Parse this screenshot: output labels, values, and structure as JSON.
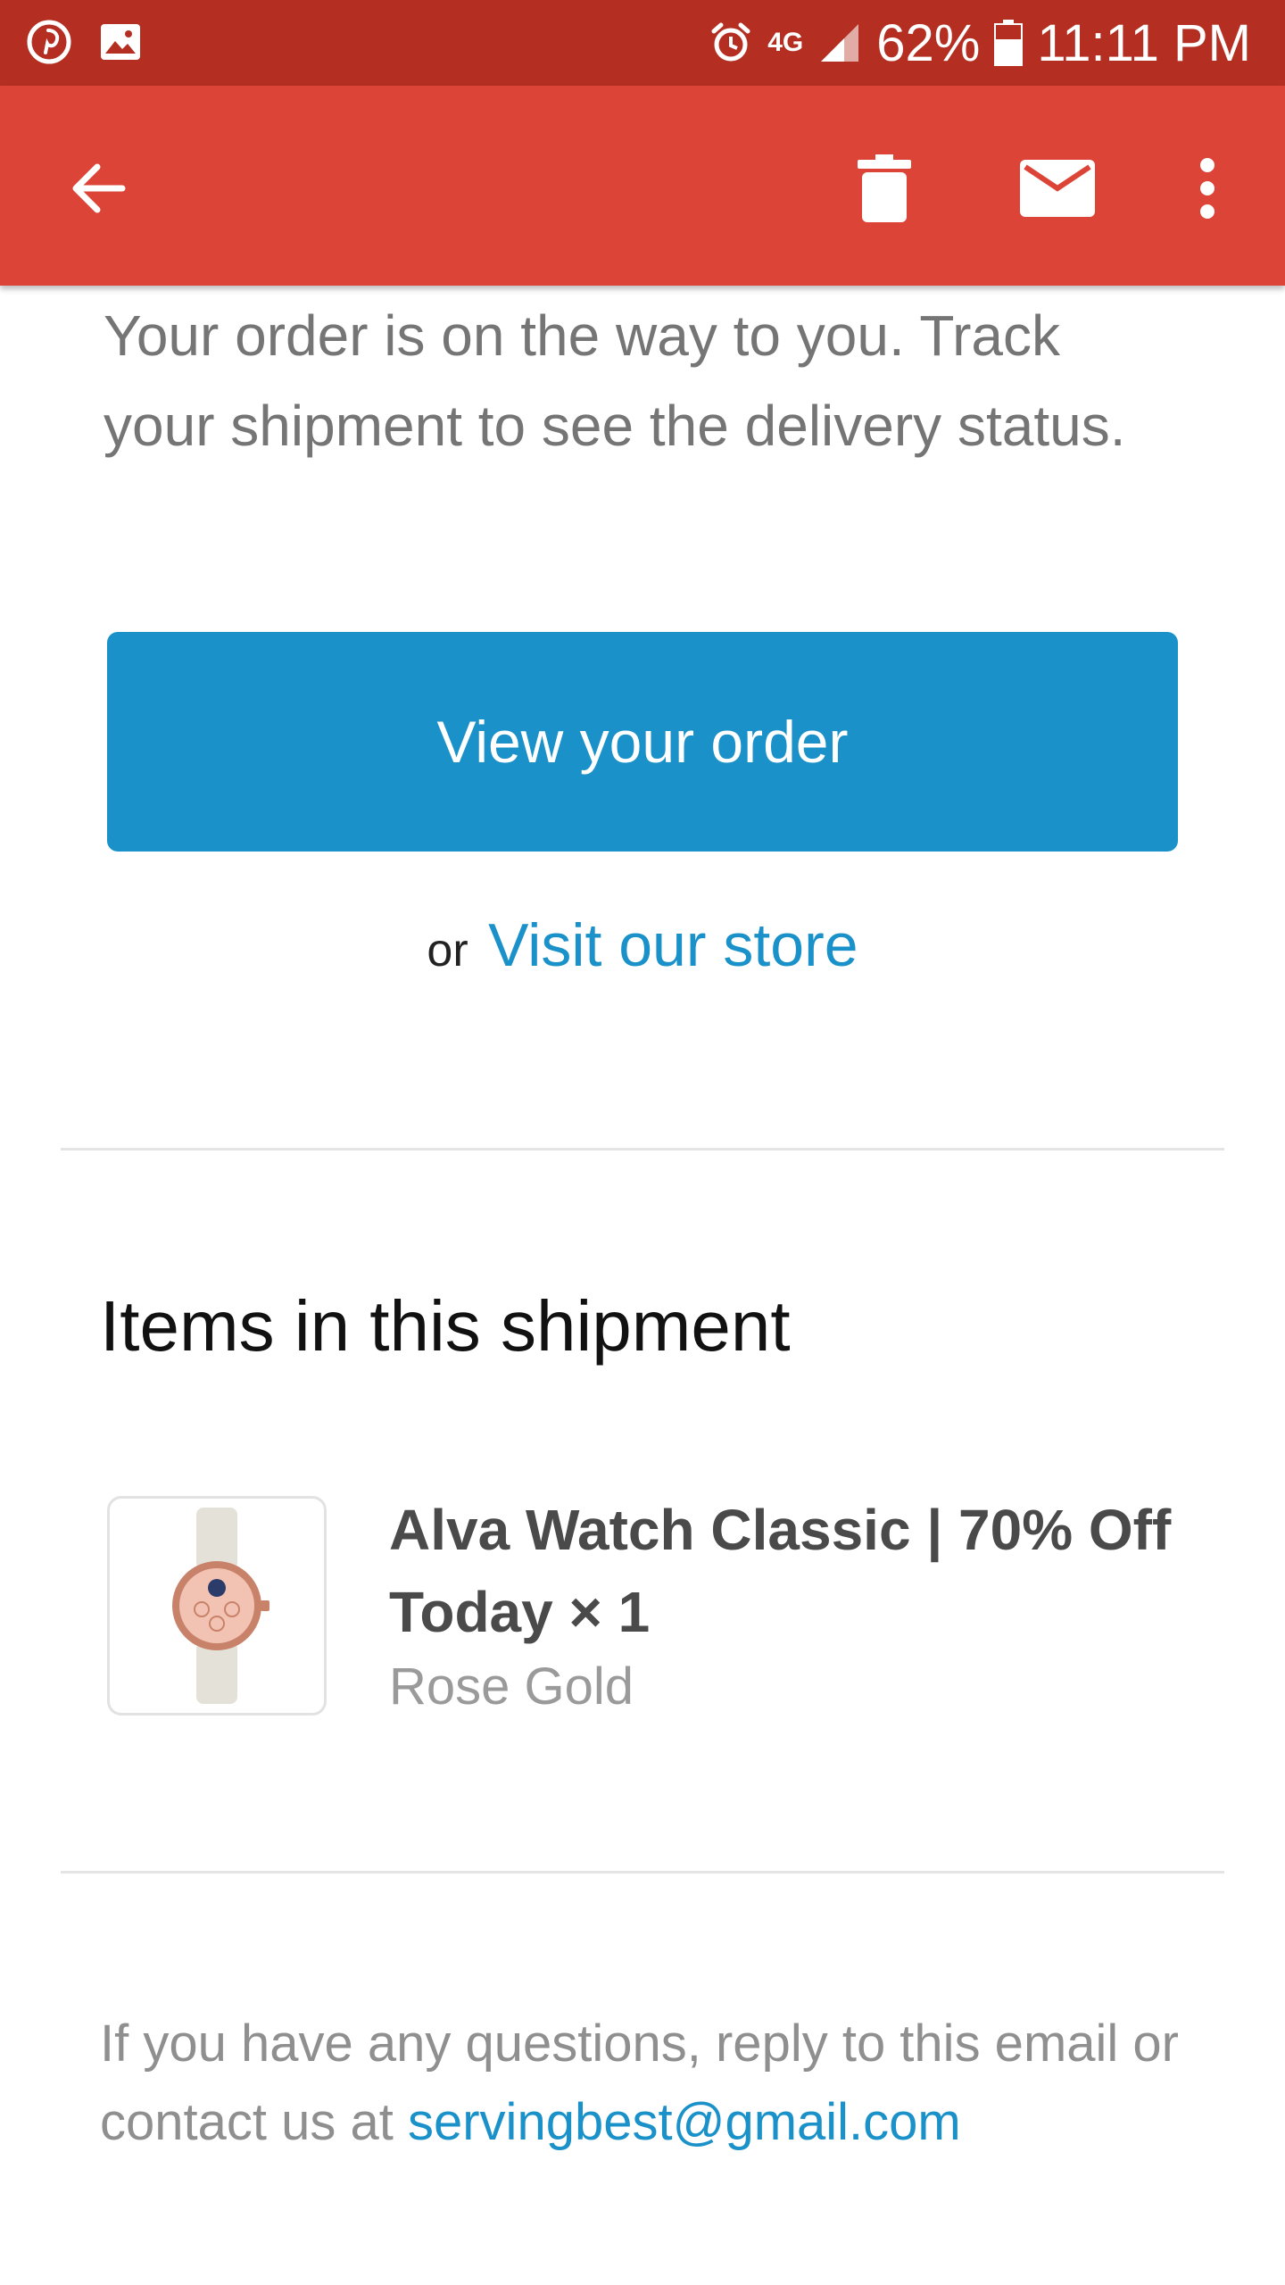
{
  "status_bar": {
    "network": "4G",
    "battery": "62%",
    "time": "11:11 PM"
  },
  "app_bar": {
    "back_icon": "arrow-left-icon",
    "delete_icon": "trash-icon",
    "mark_unread_icon": "mail-icon",
    "more_icon": "more-vert-icon"
  },
  "email": {
    "intro_text": "Your order is on the way to you. Track your shipment to see the delivery status.",
    "cta_label": "View your order",
    "or_text": "or",
    "store_link": "Visit our store",
    "items_title": "Items in this shipment",
    "items": [
      {
        "name": "Alva Watch Classic | 70% Off Today × 1",
        "variant": "Rose Gold"
      }
    ],
    "footer_text": "If you have any questions, reply to this email or contact us at",
    "footer_email": "servingbest@gmail.com"
  },
  "colors": {
    "status_bar": "#b42f22",
    "app_bar": "#db4437",
    "button": "#1a91c9",
    "link": "#1a91c9"
  }
}
